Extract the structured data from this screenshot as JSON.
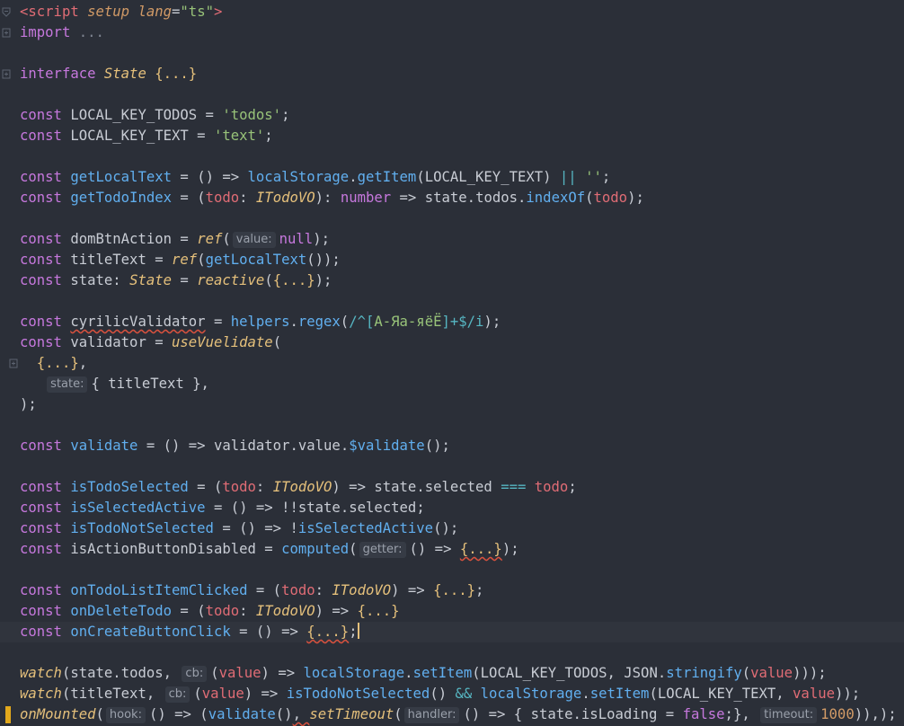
{
  "editor": {
    "file_language": "TypeScript Vue SFC",
    "lines": [
      "<script setup lang=\"ts\">",
      "import ...",
      "",
      "interface State {...}",
      "",
      "const LOCAL_KEY_TODOS = 'todos';",
      "const LOCAL_KEY_TEXT = 'text';",
      "",
      "const getLocalText = () => localStorage.getItem(LOCAL_KEY_TEXT) || '';",
      "const getTodoIndex = (todo: ITodoVO): number => state.todos.indexOf(todo);",
      "",
      "const domBtnAction = ref( value: null);",
      "const titleText = ref(getLocalText());",
      "const state: State = reactive({...});",
      "",
      "const cyrilicValidator = helpers.regex(/^[А-Яа-яёЁ]+$/i);",
      "const validator = useVuelidate(",
      "  {...},",
      "   state: { titleText },",
      ");",
      "",
      "const validate = () => validator.value.$validate();",
      "",
      "const isTodoSelected = (todo: ITodoVO) => state.selected === todo;",
      "const isSelectedActive = () => !!state.selected;",
      "const isTodoNotSelected = () => !isSelectedActive();",
      "const isActionButtonDisabled = computed( getter: () => {...});",
      "",
      "const onTodoListItemClicked = (todo: ITodoVO) => {...};",
      "const onDeleteTodo = (todo: ITodoVO) => {...}",
      "const onCreateButtonClick = () => {...};",
      "",
      "watch(state.todos,  cb: (value) => localStorage.setItem(LOCAL_KEY_TODOS, JSON.stringify(value)));",
      "watch(titleText,  cb: (value) => isTodoNotSelected() && localStorage.setItem(LOCAL_KEY_TEXT, value));",
      "onMounted( hook: () => (validate(), setTimeout( handler: () => { state.isLoading = false;},  timeout: 1000)),);"
    ],
    "current_line": 31,
    "colors": {
      "background": "#2b2f38",
      "current_line": "#30343d",
      "keyword": "#c678dd",
      "function": "#61afef",
      "string": "#98c379",
      "type": "#e5c07b",
      "param": "#e06c75",
      "number": "#d19a66"
    }
  },
  "tokens": {
    "l1": {
      "lt": "<",
      "tag": "script",
      "a1": "setup",
      "a2": "lang",
      "eq": "=",
      "val": "\"ts\"",
      "gt": ">"
    },
    "l2": {
      "kw": "import",
      "rest": " ..."
    },
    "l4": {
      "kw": "interface",
      "name": "State",
      "body": "{...}"
    },
    "l6": {
      "kw": "const",
      "name": "LOCAL_KEY_TODOS",
      "eq": " = ",
      "str": "'todos'",
      "end": ";"
    },
    "l7": {
      "kw": "const",
      "name": "LOCAL_KEY_TEXT",
      "eq": " = ",
      "str": "'text'",
      "end": ";"
    },
    "l9": {
      "kw": "const",
      "name": "getLocalText",
      "eq": " = ",
      "p": "()",
      "arrow": " => ",
      "obj": "localStorage",
      "dot": ".",
      "m": "getItem",
      "o": "(",
      "arg": "LOCAL_KEY_TEXT",
      "c": ")",
      "or": " || ",
      "str": "''",
      "end": ";"
    },
    "l10": {
      "kw": "const",
      "name": "getTodoIndex",
      "eq": " = ",
      "o": "(",
      "param": "todo",
      "colon": ": ",
      "t": "ITodoVO",
      "c": ")",
      "ret": ": ",
      "rt": "number",
      "arrow": " => ",
      "a": "state",
      "dot": ".",
      "b": "todos",
      "dot2": ".",
      "m": "indexOf",
      "o2": "(",
      "arg": "todo",
      "c2": ")",
      "end": ";"
    },
    "l12": {
      "kw": "const",
      "name": "domBtnAction",
      "eq": " = ",
      "fn": "ref",
      "o": "(",
      "hint": "value:",
      "val": "null",
      "c": ")",
      "end": ";"
    },
    "l13": {
      "kw": "const",
      "name": "titleText",
      "eq": " = ",
      "fn": "ref",
      "o": "(",
      "inner": "getLocalText",
      "p": "()",
      "c": ")",
      "end": ";"
    },
    "l14": {
      "kw": "const",
      "name": "state",
      "colon": ": ",
      "t": "State",
      "eq": " = ",
      "fn": "reactive",
      "o": "(",
      "body": "{...}",
      "c": ")",
      "end": ";"
    },
    "l16": {
      "kw": "const",
      "name": "cyrilicValidator",
      "eq": " = ",
      "obj": "helpers",
      "dot": ".",
      "m": "regex",
      "o": "(",
      "r1": "/^[",
      "r2": "А-Яа-яёЁ",
      "r3": "]+$/i",
      "c": ")",
      "end": ";"
    },
    "l17": {
      "kw": "const",
      "name": "validator",
      "eq": " = ",
      "fn": "useVuelidate",
      "o": "("
    },
    "l18": {
      "indent": "  ",
      "body": "{...}",
      "end": ","
    },
    "l19": {
      "indent": "   ",
      "hint": "state:",
      "o": "{ ",
      "v": "titleText",
      "c": " }",
      "end": ","
    },
    "l20": {
      "c": ")",
      "end": ";"
    },
    "l22": {
      "kw": "const",
      "name": "validate",
      "eq": " = ",
      "p": "()",
      "arrow": " => ",
      "a": "validator",
      "dot": ".",
      "b": "value",
      "dot2": ".",
      "m": "$validate",
      "call": "()",
      "end": ";"
    },
    "l24": {
      "kw": "const",
      "name": "isTodoSelected",
      "eq": " = ",
      "o": "(",
      "param": "todo",
      "colon": ": ",
      "t": "ITodoVO",
      "c": ")",
      "arrow": " => ",
      "a": "state",
      "dot": ".",
      "b": "selected",
      "cmp": " === ",
      "v": "todo",
      "end": ";"
    },
    "l25": {
      "kw": "const",
      "name": "isSelectedActive",
      "eq": " = ",
      "p": "()",
      "arrow": " => ",
      "not": "!!",
      "a": "state",
      "dot": ".",
      "b": "selected",
      "end": ";"
    },
    "l26": {
      "kw": "const",
      "name": "isTodoNotSelected",
      "eq": " = ",
      "p": "()",
      "arrow": " => ",
      "not": "!",
      "f": "isSelectedActive",
      "call": "()",
      "end": ";"
    },
    "l27": {
      "kw": "const",
      "name": "isActionButtonDisabled",
      "eq": " = ",
      "fn": "computed",
      "o": "(",
      "hint": "getter:",
      "p": "()",
      "arrow": " => ",
      "body": "{...}",
      "c": ")",
      "end": ";"
    },
    "l29": {
      "kw": "const",
      "name": "onTodoListItemClicked",
      "eq": " = ",
      "o": "(",
      "param": "todo",
      "colon": ": ",
      "t": "ITodoVO",
      "c": ")",
      "arrow": " => ",
      "body": "{...}",
      "end": ";"
    },
    "l30": {
      "kw": "const",
      "name": "onDeleteTodo",
      "eq": " = ",
      "o": "(",
      "param": "todo",
      "colon": ": ",
      "t": "ITodoVO",
      "c": ")",
      "arrow": " => ",
      "body": "{...}"
    },
    "l31": {
      "kw": "const",
      "name": "onCreateButtonClick",
      "eq": " = ",
      "p": "()",
      "arrow": " => ",
      "body": "{...}",
      "end": ";"
    },
    "l33": {
      "fn": "watch",
      "o": "(",
      "a": "state",
      "dot": ".",
      "b": "todos",
      "comma": ", ",
      "hint": "cb:",
      "o2": "(",
      "param": "value",
      "c2": ")",
      "arrow": " => ",
      "obj": "localStorage",
      "dot2": ".",
      "m": "setItem",
      "o3": "(",
      "arg": "LOCAL_KEY_TODOS",
      "comma2": ", ",
      "json": "JSON",
      "dot3": ".",
      "m2": "stringify",
      "o4": "(",
      "v": "value",
      "end": ")));"
    },
    "l34": {
      "fn": "watch",
      "o": "(",
      "a": "titleText",
      "comma": ", ",
      "hint": "cb:",
      "o2": "(",
      "param": "value",
      "c2": ")",
      "arrow": " => ",
      "f": "isTodoNotSelected",
      "call": "()",
      "and": " && ",
      "obj": "localStorage",
      "dot": ".",
      "m": "setItem",
      "o3": "(",
      "arg": "LOCAL_KEY_TEXT",
      "comma2": ", ",
      "v": "value",
      "end": "));"
    },
    "l35": {
      "fn": "onMounted",
      "o": "(",
      "hint": "hook:",
      "p": "()",
      "arrow": " => ",
      "o2": "(",
      "f": "validate",
      "call": "()",
      "comma": ", ",
      "fn2": "setTimeout",
      "o3": "(",
      "hint2": "handler:",
      "p2": "()",
      "arrow2": " => ",
      "ob": "{ ",
      "a": "state",
      "dot": ".",
      "b": "isLoading",
      "eq": " = ",
      "bool": "false",
      "semi": ";",
      "cb": "}",
      "comma2": ", ",
      "hint3": "timeout:",
      "num": "1000",
      "end": ")),);"
    }
  }
}
